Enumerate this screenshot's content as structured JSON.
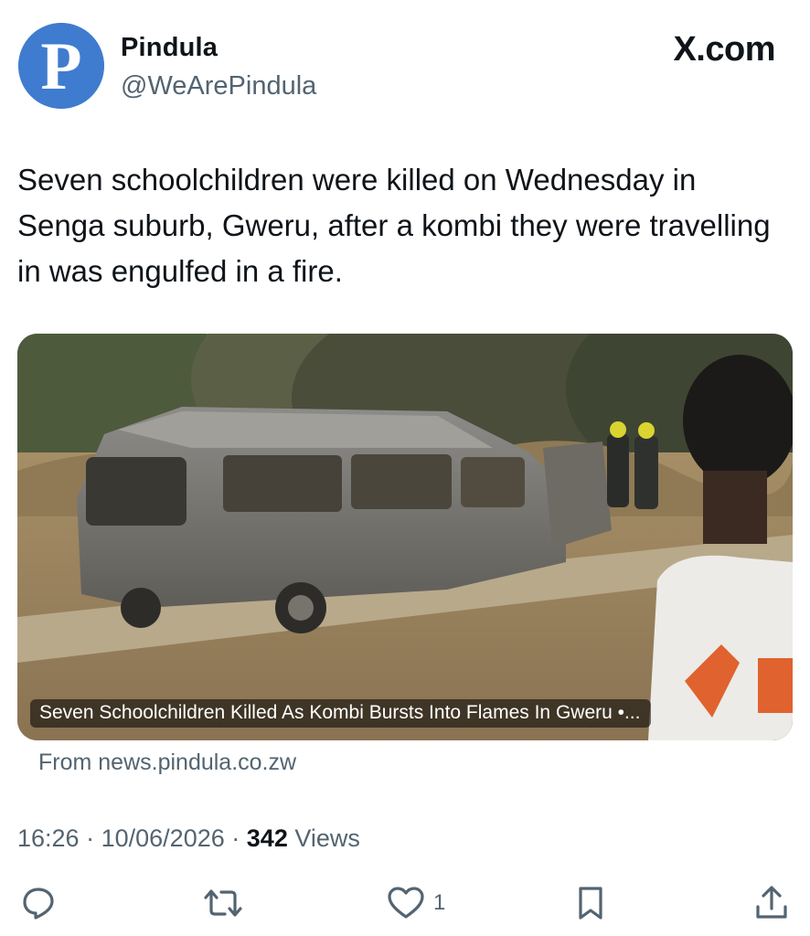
{
  "author": {
    "avatar_letter": "P",
    "display_name": "Pindula",
    "handle": "@WeArePindula"
  },
  "site_logo": "X.com",
  "tweet": {
    "text": "Seven schoolchildren were killed on Wednesday in Senga suburb, Gweru, after a kombi they were travelling in was engulfed in a fire."
  },
  "card": {
    "caption": "Seven Schoolchildren Killed As Kombi Bursts Into Flames In Gweru •...",
    "source": "From news.pindula.co.zw"
  },
  "meta": {
    "time": "16:26",
    "separator": "·",
    "date": "10/06/2026",
    "views_count": "342",
    "views_label": "Views"
  },
  "actions": {
    "reply_icon": "reply-icon",
    "retweet_icon": "retweet-icon",
    "like_icon": "heart-icon",
    "like_count": "1",
    "bookmark_icon": "bookmark-icon",
    "share_icon": "share-icon"
  },
  "colors": {
    "avatar_bg": "#3f7ccf",
    "text_primary": "#0f1419",
    "text_secondary": "#536471"
  }
}
